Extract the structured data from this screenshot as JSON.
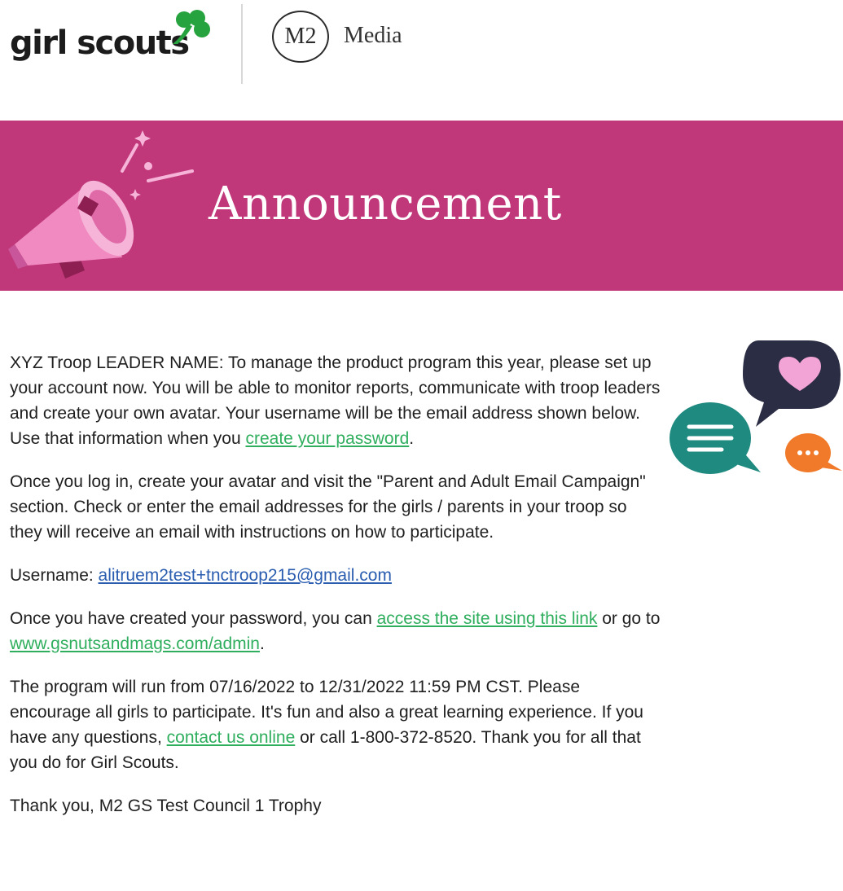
{
  "header": {
    "brand": "girl scouts",
    "partner_mark": "M2",
    "partner_name": "Media"
  },
  "banner": {
    "title": "Announcement",
    "color": "#c0387a"
  },
  "message": {
    "p1_text": "XYZ Troop LEADER NAME: To manage the product program this year, please set up your account now. You will be able to monitor reports, communicate with troop leaders and create your own avatar. Your username will be the email address shown below. Use that information when you ",
    "p1_link": "create your password",
    "p1_end": ".",
    "p2_text": "Once you log in, create your avatar and visit the \"Parent and Adult Email Campaign\" section. Check or enter the email addresses for the girls / parents in your troop so they will receive an email with instructions on how to participate.",
    "username_label": "Username: ",
    "username_value": "alitruem2test+tnctroop215@gmail.com",
    "p4_text": "Once you have created your password, you can ",
    "p4_link1": "access the site using this link",
    "p4_mid": " or go to ",
    "p4_link2": "www.gsnutsandmags.com/admin",
    "p4_end": ".",
    "p5_text": "The program will run from 07/16/2022 to 12/31/2022 11:59 PM CST. Please encourage all girls to participate. It's fun and also a great learning experience. If you have any questions, ",
    "p5_link": "contact us online",
    "p5_end": " or call 1-800-372-8520. Thank you for all that you do for Girl Scouts.",
    "signoff": "Thank you, M2 GS Test Council 1 Trophy"
  },
  "colors": {
    "link_green": "#2fae5e",
    "link_blue": "#2a5db0",
    "brand_green": "#26a33e"
  }
}
